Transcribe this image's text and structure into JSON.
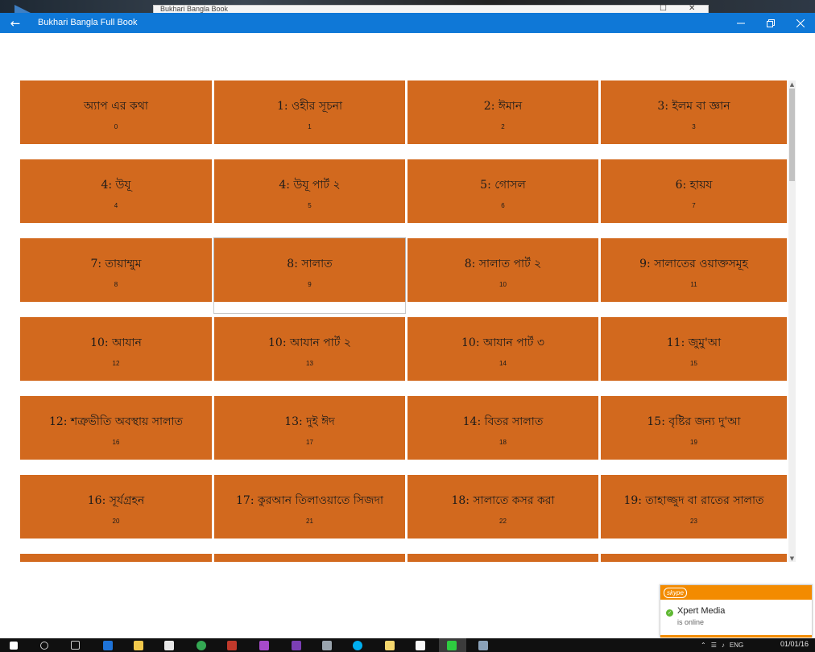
{
  "window": {
    "title": "Bukhari Bangla Full Book",
    "behind_title": "Bukhari Bangla Book"
  },
  "grid": {
    "items": [
      {
        "label": "অ্যাপ এর কথা",
        "index": "0"
      },
      {
        "label": "1: ওহীর সূচনা",
        "index": "1"
      },
      {
        "label": "2: ঈমান",
        "index": "2"
      },
      {
        "label": "3: ইলম বা জ্ঞান",
        "index": "3"
      },
      {
        "label": "4: উযূ",
        "index": "4"
      },
      {
        "label": "4: উযূ পার্ট ২",
        "index": "5"
      },
      {
        "label": "5: গোসল",
        "index": "6"
      },
      {
        "label": "6: হায়য",
        "index": "7"
      },
      {
        "label": "7: তায়াম্মুম",
        "index": "8"
      },
      {
        "label": "8: সালাত",
        "index": "9"
      },
      {
        "label": "8: সালাত পার্ট ২",
        "index": "10"
      },
      {
        "label": "9: সালাতের ওয়াক্তসমূহ",
        "index": "11"
      },
      {
        "label": "10: আযান",
        "index": "12"
      },
      {
        "label": "10: আযান পার্ট ২",
        "index": "13"
      },
      {
        "label": "10: আযান পার্ট ৩",
        "index": "14"
      },
      {
        "label": "11: জুমু'আ",
        "index": "15"
      },
      {
        "label": "12: শত্রুভীতি অবস্থায় সালাত",
        "index": "16"
      },
      {
        "label": "13: দুই ঈদ",
        "index": "17"
      },
      {
        "label": "14: বিতর সালাত",
        "index": "18"
      },
      {
        "label": "15: বৃষ্টির জন্য দু'আ",
        "index": "19"
      },
      {
        "label": "16: সূর্যগ্রহন",
        "index": "20"
      },
      {
        "label": "17: কুরআন তিলাওয়াতে সিজদা",
        "index": "21"
      },
      {
        "label": "18: সালাতে কসর করা",
        "index": "22"
      },
      {
        "label": "19: তাহাজ্জুদ বা রাতের সালাত",
        "index": "23"
      },
      {
        "label": "",
        "index": ""
      },
      {
        "label": "",
        "index": ""
      },
      {
        "label": "",
        "index": ""
      },
      {
        "label": "",
        "index": ""
      }
    ],
    "selected_index": 9
  },
  "toast": {
    "brand": "skype",
    "contact_name": "Xpert Media",
    "status": "is online"
  },
  "taskbar": {
    "tray_lang": "ENG",
    "clock_date": "01/01/16"
  },
  "colors": {
    "titlebar": "#0f78d7",
    "tile": "#d2691e",
    "skype_orange": "#f38b00"
  }
}
